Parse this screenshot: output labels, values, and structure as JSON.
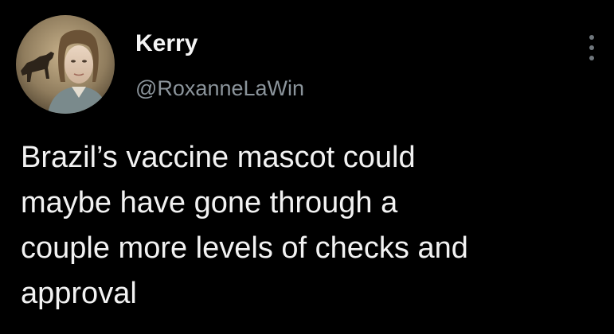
{
  "tweet": {
    "author": {
      "display_name": "Kerry",
      "handle": "@RoxanneLaWin",
      "avatar_icon": "profile-photo-woman-with-horse-icon"
    },
    "more_icon": "vertical-ellipsis-icon",
    "text_lines": [
      "Brazil’s vaccine mascot could",
      "maybe have gone through a",
      "couple more levels of checks and",
      "approval"
    ]
  },
  "colors": {
    "background": "#000000",
    "text": "#f2f2f2",
    "secondary_text": "#8b949b"
  }
}
